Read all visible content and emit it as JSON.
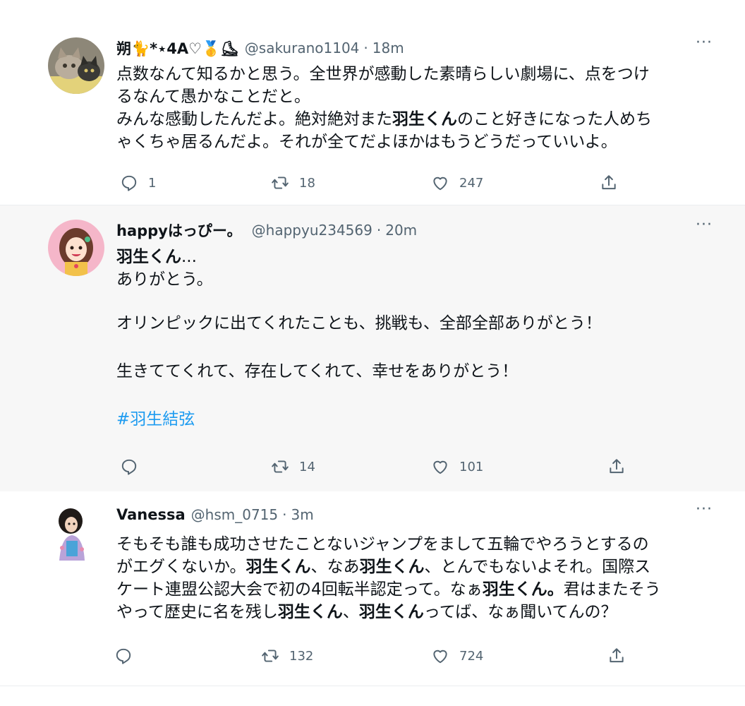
{
  "tweets": [
    {
      "name": "朔🐈*⋆4A♡🥇⛸",
      "handle": "@sakurano1104",
      "time": "18m",
      "more": "···",
      "body": {
        "l1": "点数なんて知るかと思う。全世界が感動した素晴らしい劇場に、点をつけ",
        "l2": "るなんて愚かなことだと。",
        "l3a": "みんな感動したんだよ。絶対絶対また",
        "l3b": "羽生くん",
        "l3c": "のこと好きになった人めち",
        "l4": "ゃくちゃ居るんだよ。それが全てだよほかはもうどうだっていいよ。"
      },
      "actions": {
        "reply": "1",
        "retweet": "18",
        "like": "247"
      }
    },
    {
      "name": "happyはっぴー。",
      "handle": "@happyu234569",
      "time": "20m",
      "more": "···",
      "body": {
        "l1a": "羽生くん",
        "l1b": "...",
        "l2": "ありがとう。",
        "l3": "オリンピックに出てくれたことも、挑戦も、全部全部ありがとう！",
        "l4": "生きててくれて、存在してくれて、幸せをありがとう！",
        "hashtag": "#羽生結弦"
      },
      "actions": {
        "reply": "",
        "retweet": "14",
        "like": "101"
      }
    },
    {
      "name": "Vanessa",
      "handle": "@hsm_0715",
      "time": "3m",
      "more": "···",
      "body": {
        "l1": "そもそも誰も成功させたことないジャンプをまして五輪でやろうとするの",
        "l2a": "がエグくないか。",
        "l2b": "羽生くん",
        "l2c": "、なあ",
        "l2d": "羽生くん",
        "l2e": "、とんでもないよそれ。国際ス",
        "l3a": "ケート連盟公認大会で初の4回転半認定って。なぁ",
        "l3b": "羽生くん。",
        "l3c": "君はまたそう",
        "l4a": "やって歴史に名を残し",
        "l4b": "羽生くん",
        "l4c": "、",
        "l4d": "羽生くん",
        "l4e": "ってば、なぁ聞いてんの？"
      },
      "actions": {
        "reply": "",
        "retweet": "132",
        "like": "724"
      }
    }
  ]
}
